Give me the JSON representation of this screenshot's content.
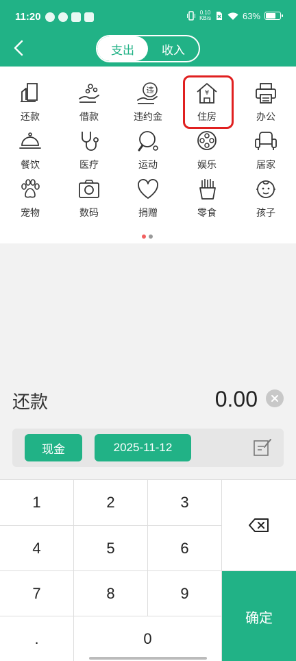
{
  "status": {
    "time": "11:20",
    "speed_value": "0.10",
    "speed_unit": "KB/s",
    "battery": "63%"
  },
  "header": {
    "tabs": [
      {
        "label": "支出"
      },
      {
        "label": "收入"
      }
    ]
  },
  "categories": [
    {
      "label": "还款",
      "icon": "repay-icon"
    },
    {
      "label": "借款",
      "icon": "borrow-icon"
    },
    {
      "label": "违约金",
      "icon": "penalty-icon"
    },
    {
      "label": "住房",
      "icon": "house-icon"
    },
    {
      "label": "办公",
      "icon": "printer-icon"
    },
    {
      "label": "餐饮",
      "icon": "dining-icon"
    },
    {
      "label": "医疗",
      "icon": "stethoscope-icon"
    },
    {
      "label": "运动",
      "icon": "ping-pong-icon"
    },
    {
      "label": "娱乐",
      "icon": "film-reel-icon"
    },
    {
      "label": "居家",
      "icon": "armchair-icon"
    },
    {
      "label": "宠物",
      "icon": "paw-icon"
    },
    {
      "label": "数码",
      "icon": "camera-icon"
    },
    {
      "label": "捐赠",
      "icon": "heart-icon"
    },
    {
      "label": "零食",
      "icon": "fries-icon"
    },
    {
      "label": "孩子",
      "icon": "baby-icon"
    }
  ],
  "penalty_glyph": "违",
  "house_glyph": "¥",
  "entry": {
    "category": "还款",
    "amount": "0.00"
  },
  "options": {
    "account": "现金",
    "date": "2025-11-12"
  },
  "keypad": {
    "keys": [
      "1",
      "2",
      "3",
      "4",
      "5",
      "6",
      "7",
      "8",
      "9",
      ".",
      "0"
    ],
    "confirm": "确定"
  },
  "colors": {
    "accent": "#21b286",
    "highlight": "#e02020"
  }
}
